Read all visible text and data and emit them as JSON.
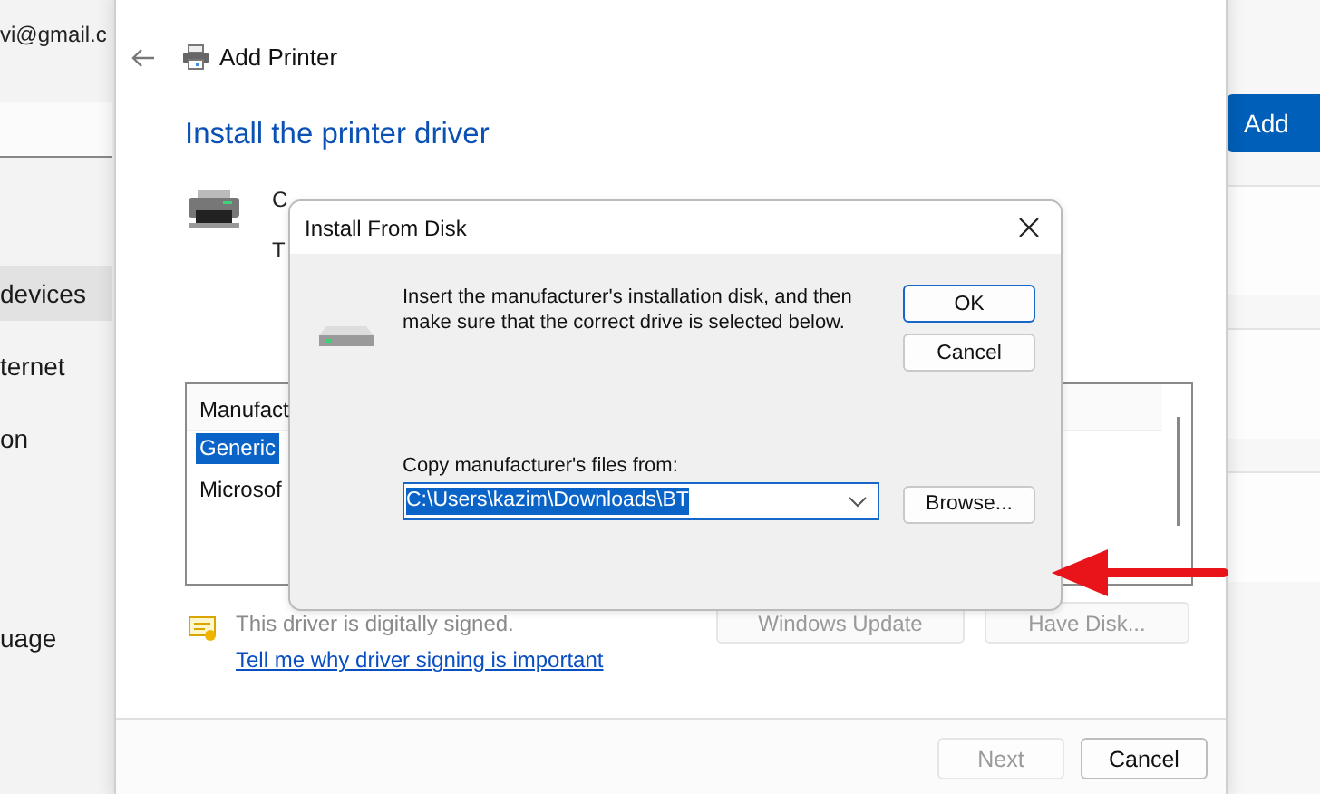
{
  "settings_sidebar": {
    "account_email": "vi@gmail.c",
    "items": [
      {
        "label": "devices",
        "selected": true
      },
      {
        "label": "ternet",
        "selected": false
      },
      {
        "label": "on",
        "selected": false
      },
      {
        "label": "uage",
        "selected": false
      }
    ]
  },
  "settings_panel": {
    "add_button": "Add"
  },
  "wizard": {
    "title": "Add Printer",
    "heading": "Install the printer driver",
    "info_lines": [
      "C",
      "T"
    ],
    "list": {
      "column": "Manufact",
      "items": [
        {
          "label": "Generic",
          "selected": true
        },
        {
          "label": "Microsof",
          "selected": false
        }
      ]
    },
    "signature_note": "This driver is digitally signed.",
    "signing_link": "Tell me why driver signing is important",
    "buttons": [
      {
        "label": "Windows Update",
        "disabled": true
      },
      {
        "label": "Have Disk...",
        "disabled": true
      }
    ],
    "footer_buttons": [
      {
        "label": "Next",
        "disabled": true
      },
      {
        "label": "Cancel",
        "disabled": false
      }
    ]
  },
  "dialog": {
    "title": "Install From Disk",
    "message": "Insert the manufacturer's installation disk, and then make sure that the correct drive is selected below.",
    "buttons": [
      {
        "label": "OK",
        "focused": true
      },
      {
        "label": "Cancel",
        "focused": false
      }
    ],
    "path_label": "Copy manufacturer's files from:",
    "path_value": "C:\\Users\\kazim\\Downloads\\BT",
    "browse_button": "Browse..."
  }
}
